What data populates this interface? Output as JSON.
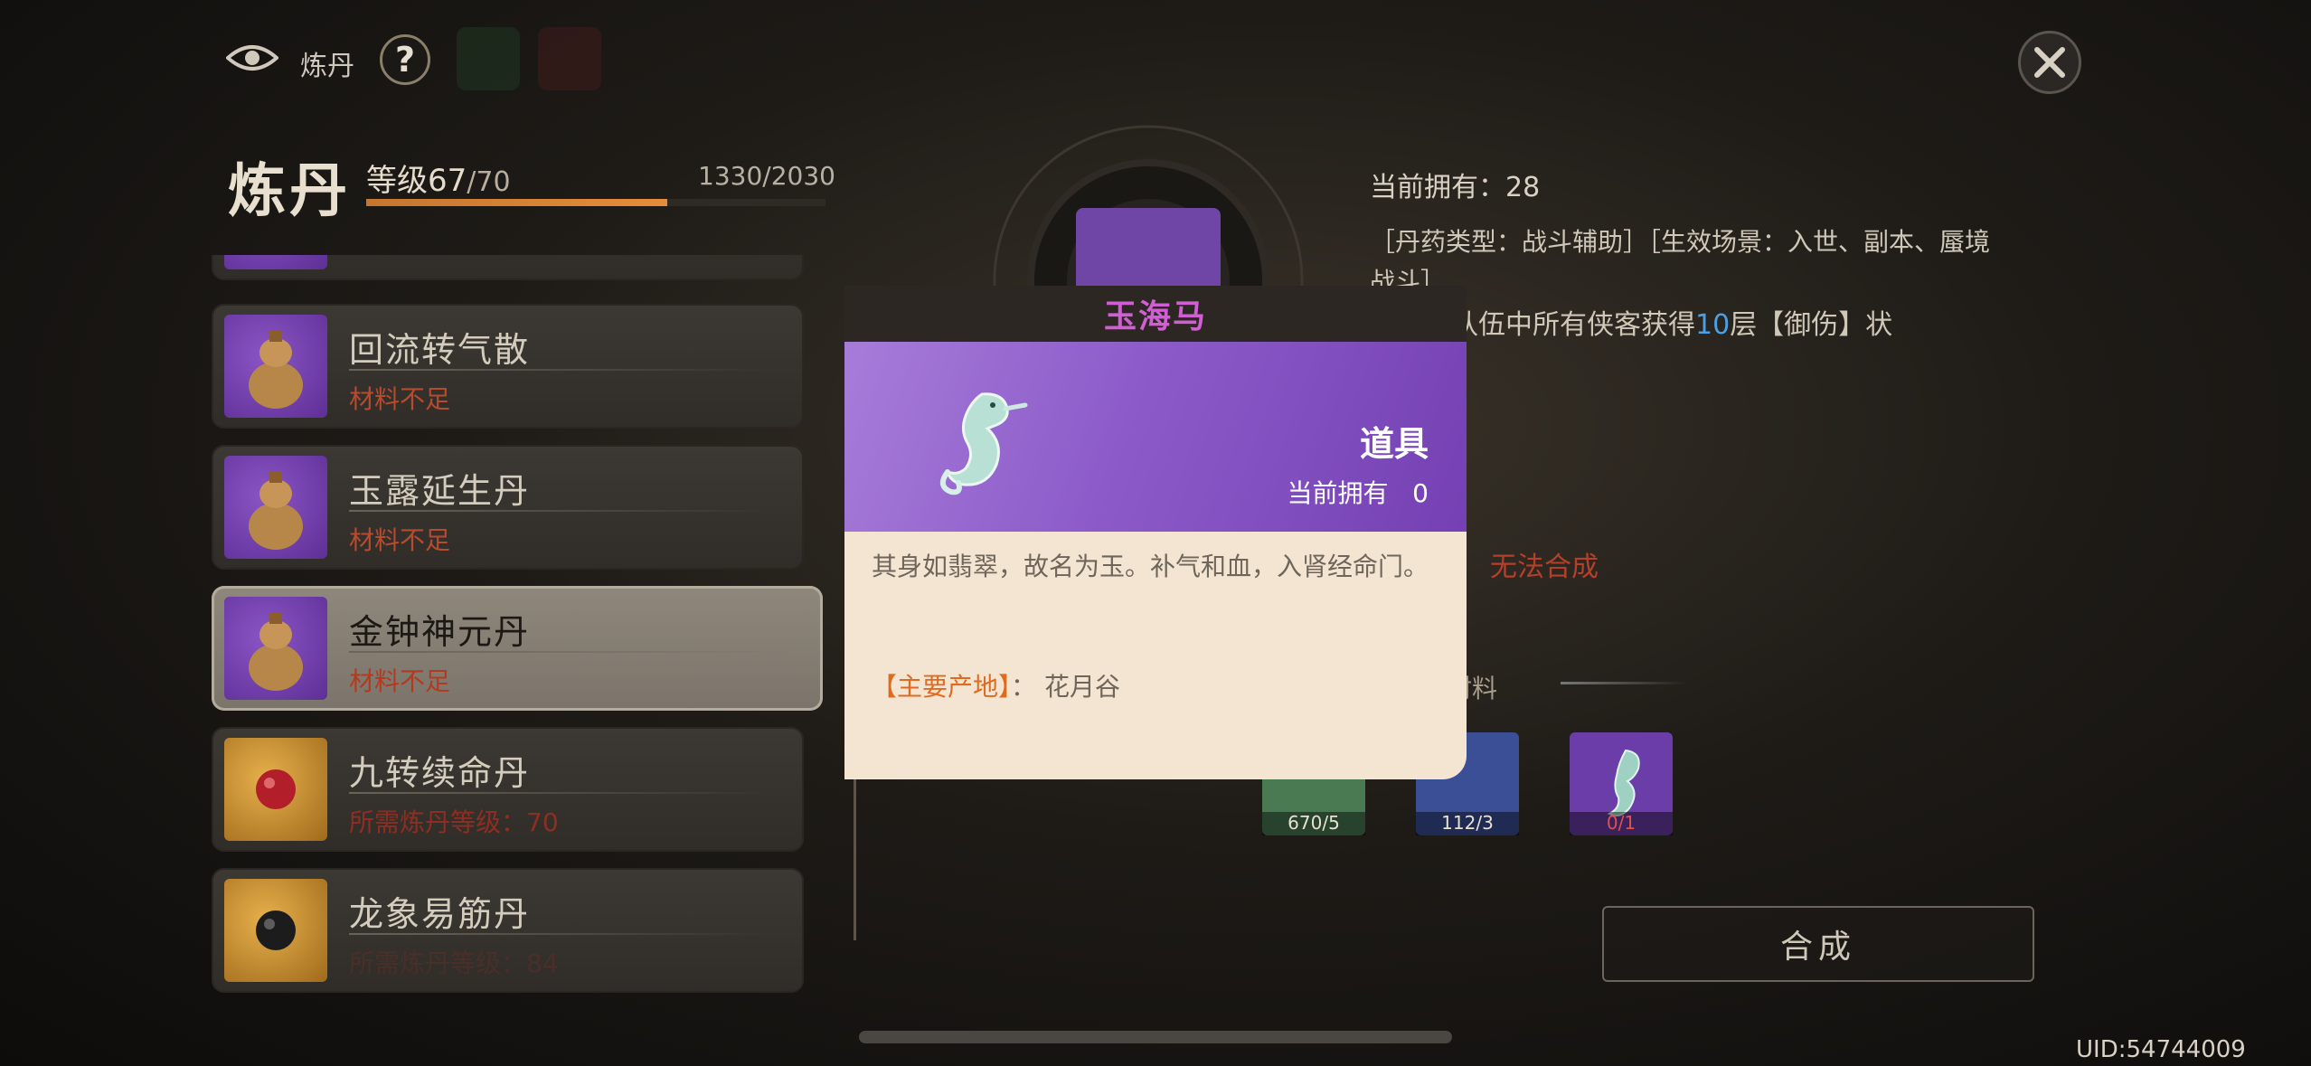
{
  "topbar": {
    "title": "炼丹",
    "help_label": "?",
    "icons": [
      "eye-icon",
      "help-icon",
      "close-icon"
    ]
  },
  "header": {
    "title": "炼丹",
    "level_prefix": "等级",
    "level": "67",
    "level_cap": "/70",
    "exp_text": "1330/2030",
    "exp_fraction": 0.655
  },
  "recipes": [
    {
      "name": "回流转气散",
      "status": "材料不足",
      "icon": "gourd-purple"
    },
    {
      "name": "玉露延生丹",
      "status": "材料不足",
      "icon": "gourd-purple"
    },
    {
      "name": "金钟神元丹",
      "status": "材料不足",
      "icon": "gourd-purple",
      "selected": true
    },
    {
      "name": "九转续命丹",
      "status": "所需炼丹等级：70",
      "icon": "pill-gold-red"
    },
    {
      "name": "龙象易筋丹",
      "status": "所需炼丹等级：84",
      "icon": "pill-gold-black"
    }
  ],
  "detail": {
    "owned": "当前拥有：28",
    "type_line": "［丹药类型：战斗辅助］［生效场景：入世、副本、蜃境战斗］",
    "effect_prefix": "始时，队伍中所有侠客获得",
    "effect_num": "10",
    "effect_suffix": "层【御伤】状",
    "cannot": "无法合成",
    "materials_label": "材料",
    "materials": [
      {
        "count": "670/5",
        "color": "#4a7a52"
      },
      {
        "count": "112/3",
        "color": "#3a4f96"
      },
      {
        "count": "0/1",
        "color": "#6a3da8"
      }
    ],
    "synth_button": "合成"
  },
  "popup": {
    "title": "玉海马",
    "type": "道具",
    "owned_label": "当前拥有",
    "owned_value": "0",
    "description": "其身如翡翠，故名为玉。补气和血，入肾经命门。",
    "origin_key": "【主要产地】",
    "origin_sep": "：",
    "origin_value": "花月谷"
  },
  "footer": {
    "uid": "UID:54744009"
  }
}
